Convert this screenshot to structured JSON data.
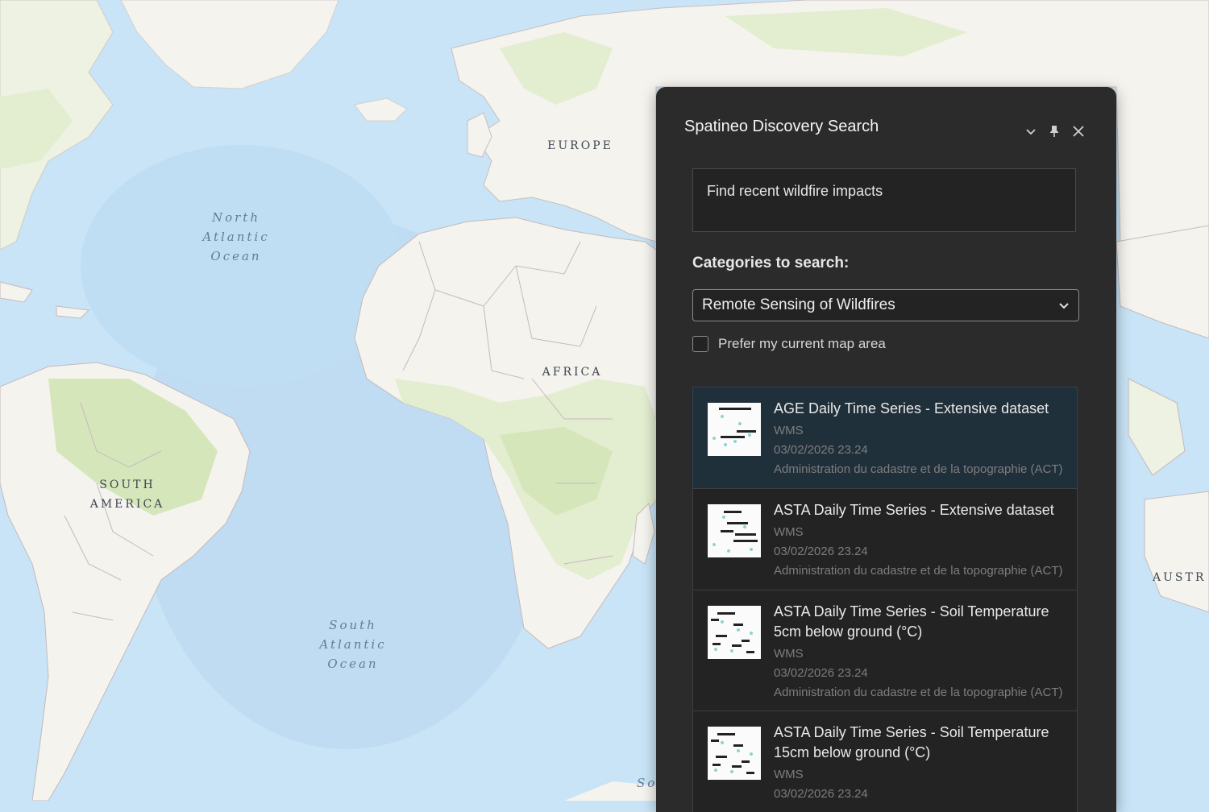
{
  "map": {
    "labels": {
      "north_atlantic": "North\nAtlantic\nOcean",
      "south_atlantic": "South\nAtlantic\nOcean",
      "europe": "EUROPE",
      "africa": "AFRICA",
      "south_america": "SOUTH\nAMERICA",
      "australia": "AUSTR",
      "south_partial": "So"
    },
    "colors": {
      "ocean": "#c8e4f6",
      "land": "#f4f3ee",
      "vegetation": "#e3edcf",
      "border": "#c6b9bd"
    }
  },
  "panel": {
    "title": "Spatineo Discovery Search",
    "controls": [
      "chevron-down-icon",
      "pin-icon",
      "close-icon"
    ],
    "search": {
      "value": "Find recent wildfire impacts"
    },
    "categories_label": "Categories to search:",
    "category_selected": "Remote Sensing of Wildfires",
    "prefer_area": {
      "label": "Prefer my current map area",
      "checked": false
    },
    "results": [
      {
        "title": "AGE Daily Time Series - Extensive dataset",
        "type": "WMS",
        "date": "03/02/2026 23.24",
        "provider": "Administration du cadastre et de la topographie (ACT)",
        "selected": true
      },
      {
        "title": "ASTA Daily Time Series - Extensive dataset",
        "type": "WMS",
        "date": "03/02/2026 23.24",
        "provider": "Administration du cadastre et de la topographie (ACT)",
        "selected": false
      },
      {
        "title": "ASTA Daily Time Series - Soil Temperature 5cm below ground (°C)",
        "type": "WMS",
        "date": "03/02/2026 23.24",
        "provider": "Administration du cadastre et de la topographie (ACT)",
        "selected": false
      },
      {
        "title": "ASTA Daily Time Series - Soil Temperature 15cm below ground (°C)",
        "type": "WMS",
        "date": "03/02/2026 23.24",
        "provider": "",
        "selected": false
      }
    ]
  }
}
